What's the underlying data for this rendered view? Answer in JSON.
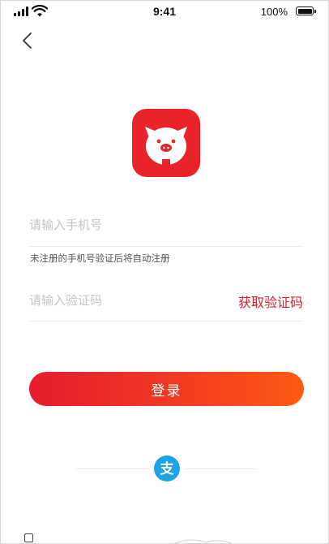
{
  "status_bar": {
    "time": "9:41",
    "battery_percent": "100%"
  },
  "nav": {
    "back_icon": "chevron-left-icon"
  },
  "app": {
    "logo_icon": "pig-icon",
    "brand_color": "#e8242a"
  },
  "login_form": {
    "phone_placeholder": "请输入手机号",
    "phone_hint": "未注册的手机号验证后将自动注册",
    "code_placeholder": "请输入验证码",
    "get_code_label": "获取验证码",
    "submit_label": "登录"
  },
  "third_party": {
    "alipay_icon": "alipay-icon",
    "alipay_glyph": "支",
    "alipay_color": "#1ea3e6"
  },
  "accent_color": "#d6212a"
}
